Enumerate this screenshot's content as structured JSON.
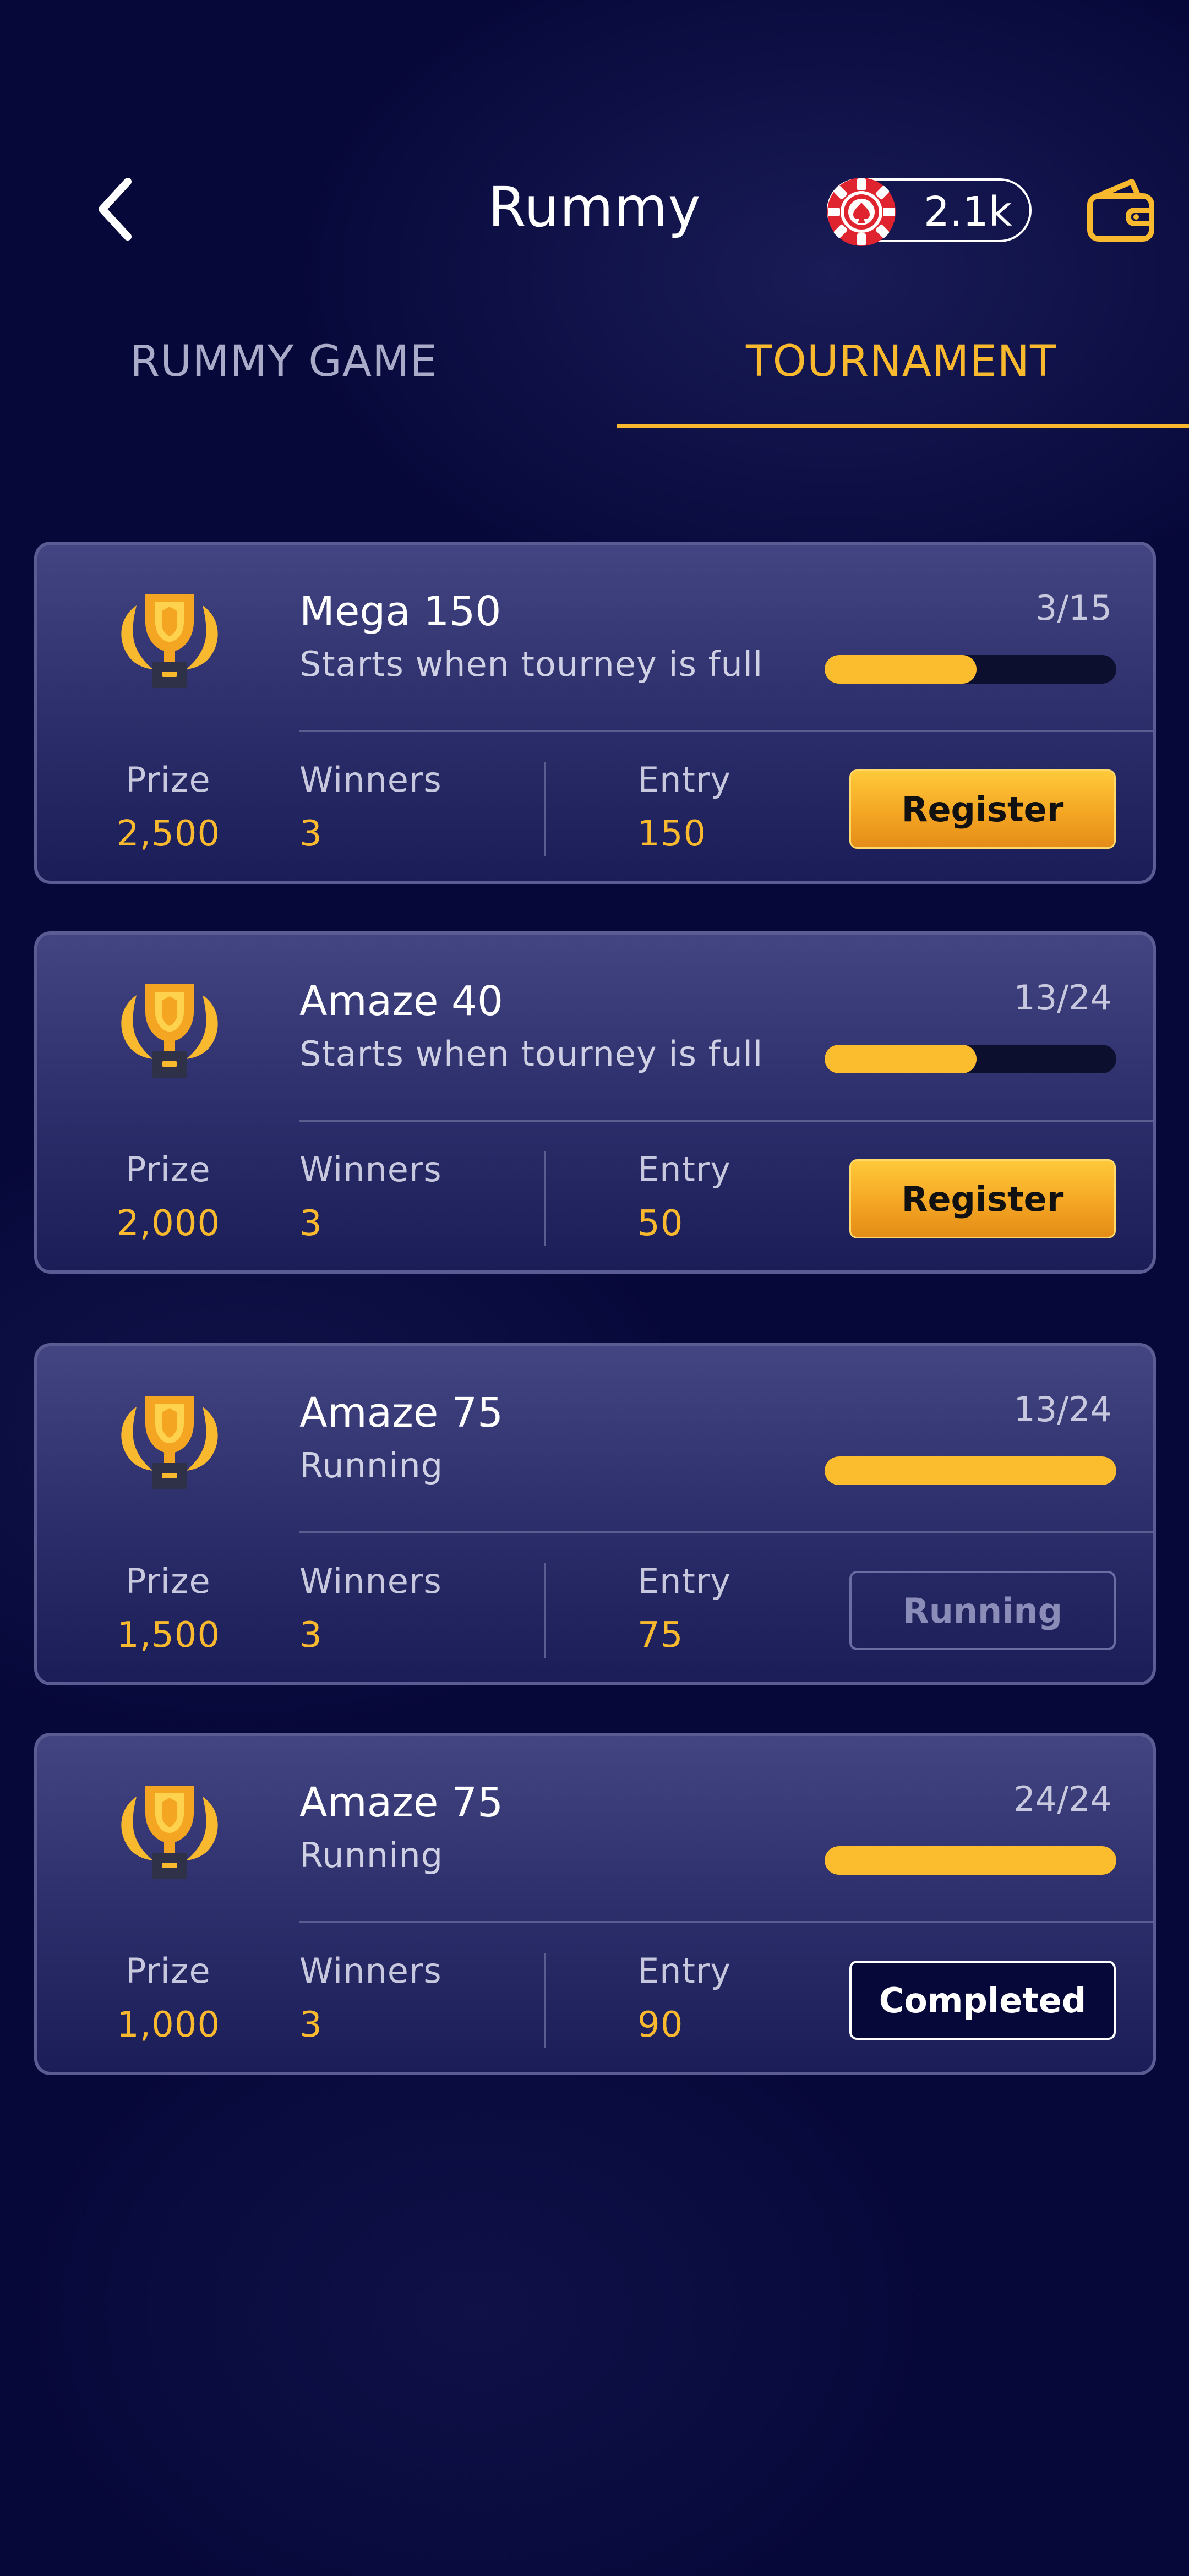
{
  "header": {
    "title": "Rummy",
    "coin_balance": "2.1k"
  },
  "tabs": [
    {
      "label": "RUMMY GAME",
      "active": false
    },
    {
      "label": "TOURNAMENT",
      "active": true
    }
  ],
  "colors": {
    "background": "#07083a",
    "accent": "#f9b92e",
    "card_border": "#5a5c93"
  },
  "tournaments": [
    {
      "name": "Mega 150",
      "status": "Starts when tourney is full",
      "count": "3/15",
      "progress": 0.52,
      "prize_label": "Prize",
      "prize": "2,500",
      "winners_label": "Winners",
      "winners": "3",
      "entry_label": "Entry",
      "entry": "150",
      "action": "Register"
    },
    {
      "name": "Amaze 40",
      "status": "Starts when tourney is full",
      "count": "13/24",
      "progress": 0.52,
      "prize_label": "Prize",
      "prize": "2,000",
      "winners_label": "Winners",
      "winners": "3",
      "entry_label": "Entry",
      "entry": "50",
      "action": "Register"
    },
    {
      "name": "Amaze 75",
      "status": "Running",
      "count": "13/24",
      "progress": 1.0,
      "prize_label": "Prize",
      "prize": "1,500",
      "winners_label": "Winners",
      "winners": "3",
      "entry_label": "Entry",
      "entry": "75",
      "action": "Running"
    },
    {
      "name": "Amaze 75",
      "status": "Running",
      "count": "24/24",
      "progress": 1.0,
      "prize_label": "Prize",
      "prize": "1,000",
      "winners_label": "Winners",
      "winners": "3",
      "entry_label": "Entry",
      "entry": "90",
      "action": "Completed"
    }
  ]
}
